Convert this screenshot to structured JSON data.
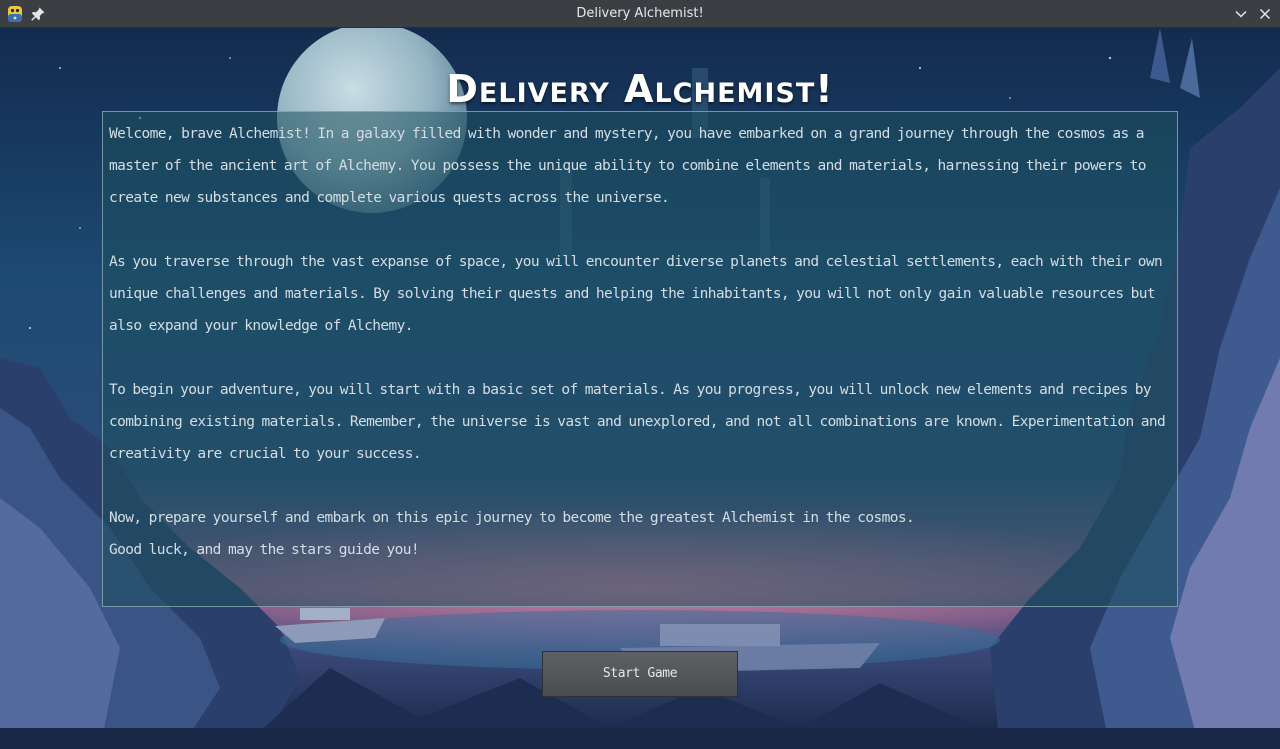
{
  "window": {
    "title": "Delivery Alchemist!",
    "icons": [
      "python-app-icon",
      "pin-icon",
      "minimize-icon",
      "close-icon"
    ]
  },
  "game": {
    "title": "Delivery Alchemist!",
    "story": {
      "paragraph1": "Welcome, brave Alchemist! In a galaxy filled with wonder and mystery, you have embarked on a grand journey through the cosmos as a master of the ancient art of Alchemy. You possess the unique ability to combine elements and materials, harnessing their powers to create new substances and complete various quests across the universe.",
      "paragraph2": "As you traverse through the vast expanse of space, you will encounter diverse planets and celestial settlements, each with their own unique challenges and materials. By solving their quests and helping the inhabitants, you will not only gain valuable resources but also expand your knowledge of Alchemy.",
      "paragraph3": "To begin your adventure, you will start with a basic set of materials. As you progress, you will unlock new elements and recipes by combining existing materials. Remember, the universe is vast and unexplored, and not all combinations are known. Experimentation and creativity are crucial to your success.",
      "paragraph4": "Now, prepare yourself and embark on this epic journey to become the greatest Alchemist in the cosmos.",
      "paragraph5": "Good luck, and may the stars guide you!"
    },
    "start_button_label": "Start Game"
  },
  "colors": {
    "titlebar": "#3b3f44",
    "sky_top": "#16325a",
    "sky_mid": "#1f4a72",
    "horizon_glow": "#c46a8a",
    "panel_fill": "#1e505f",
    "panel_border": "#96afb9",
    "text": "#d4dde3",
    "button": "#55585b"
  }
}
